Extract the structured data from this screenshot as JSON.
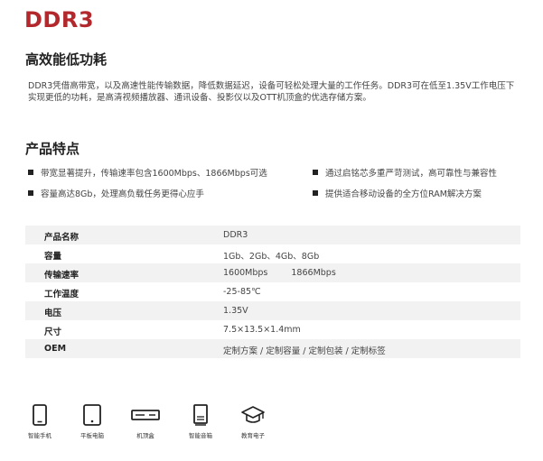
{
  "title": "DDR3",
  "section1": {
    "heading": "高效能低功耗",
    "text": "DDR3凭借高带宽，以及高速性能传输数据，降低数据延迟，设备可轻松处理大量的工作任务。DDR3可在低至1.35V工作电压下实现更低的功耗，是高清视频播放器、通讯设备、投影仪以及OTT机顶盒的优选存储方案。"
  },
  "section2": {
    "heading": "产品特点",
    "features": [
      "带宽显著提升，传输速率包含1600Mbps、1866Mbps可选",
      "通过启铭芯多重严苛测试，高可靠性与兼容性",
      "容量高达8Gb，处理高负载任务更得心应手",
      "提供适合移动设备的全方位RAM解决方案"
    ]
  },
  "specs": [
    {
      "key": "产品名称",
      "value": "DDR3"
    },
    {
      "key": "容量",
      "value": "1Gb、2Gb、4Gb、8Gb"
    },
    {
      "key": "传输速率",
      "value": "1600Mbps",
      "value2": "1866Mbps"
    },
    {
      "key": "工作温度",
      "value": "-25-85℃"
    },
    {
      "key": "电压",
      "value": "1.35V"
    },
    {
      "key": "尺寸",
      "value": "7.5×13.5×1.4mm"
    },
    {
      "key": "OEM",
      "value": "定制方案 / 定制容量 / 定制包装 / 定制标签"
    }
  ],
  "applications": [
    {
      "label": "智能手机",
      "icon": "smartphone-icon"
    },
    {
      "label": "平板电脑",
      "icon": "tablet-icon"
    },
    {
      "label": "机顶盒",
      "icon": "set-top-box-icon"
    },
    {
      "label": "智能音箱",
      "icon": "smart-speaker-icon"
    },
    {
      "label": "教育电子",
      "icon": "graduation-cap-icon"
    }
  ],
  "colors": {
    "title": "#b3282d",
    "row_alt": "#f2f2f2",
    "icon": "#222222"
  }
}
